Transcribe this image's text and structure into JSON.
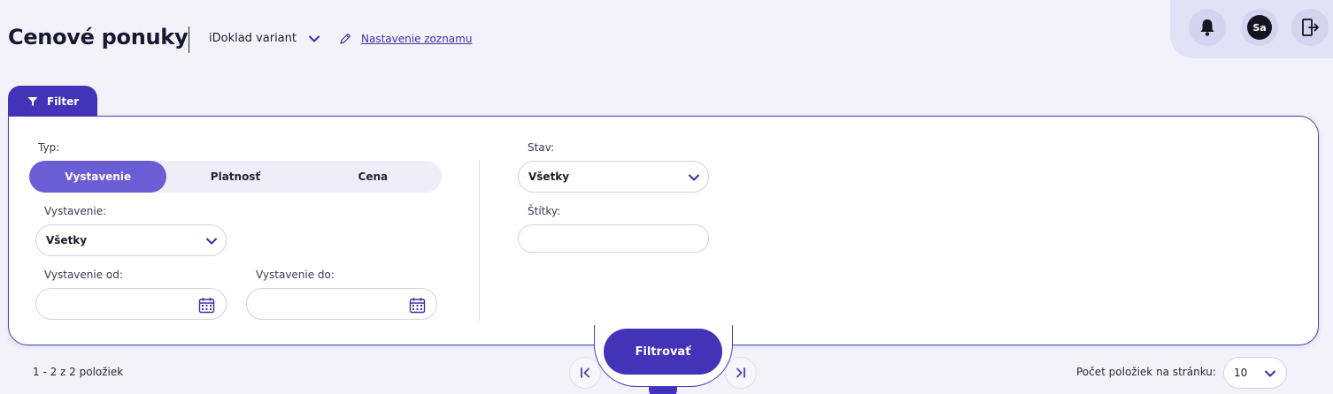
{
  "header": {
    "title": "Cenové ponuky",
    "variant_label": "iDoklad variant",
    "settings_link": "Nastavenie zoznamu"
  },
  "topbar": {
    "avatar_initials": "Sa"
  },
  "filter": {
    "tab_label": "Filter",
    "type_label": "Typ:",
    "type_options": [
      "Vystavenie",
      "Platnosť",
      "Cena"
    ],
    "type_selected": "Vystavenie",
    "issue_label": "Vystavenie:",
    "issue_value": "Všetky",
    "issue_from_label": "Vystavenie od:",
    "issue_from_value": "",
    "issue_to_label": "Vystavenie do:",
    "issue_to_value": "",
    "state_label": "Stav:",
    "state_value": "Všetky",
    "tags_label": "Štítky:",
    "tags_value": "",
    "submit_label": "Filtrovať"
  },
  "footer": {
    "count_text": "1 - 2 z 2 položiek",
    "per_page_label": "Počet položiek na stránku:",
    "per_page_value": "10"
  },
  "colors": {
    "accent": "#4233b8",
    "accent_light": "#6b5dd3",
    "background": "#f3f2fa"
  },
  "icons": [
    "chevron-down-icon",
    "pencil-icon",
    "bell-icon",
    "logout-icon",
    "funnel-icon",
    "calendar-icon",
    "first-page-icon",
    "last-page-icon"
  ]
}
